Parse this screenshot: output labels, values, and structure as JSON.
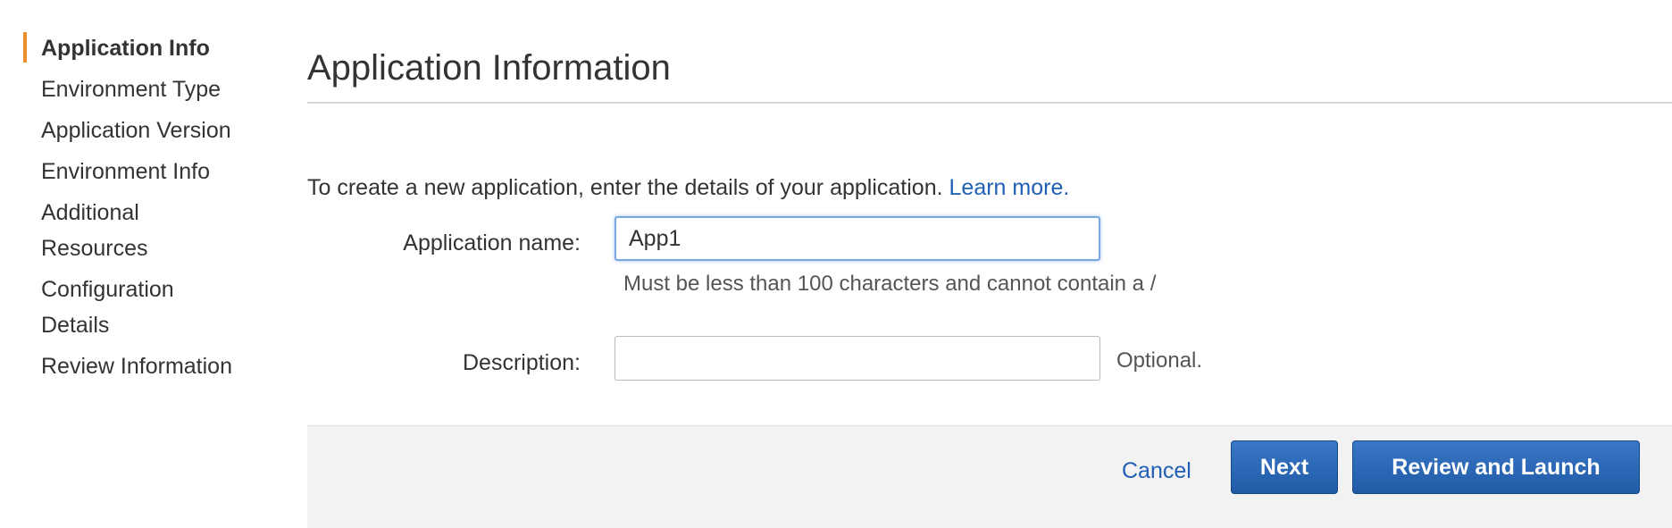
{
  "sidebar": {
    "items": [
      {
        "label": "Application Info",
        "active": true
      },
      {
        "label": "Environment Type"
      },
      {
        "label": "Application Version"
      },
      {
        "label": "Environment Info"
      },
      {
        "label": "Additional Resources"
      },
      {
        "label": "Configuration Details"
      },
      {
        "label": "Review Information"
      }
    ]
  },
  "main": {
    "title": "Application Information",
    "intro_text": "To create a new application, enter the details of your application.",
    "learn_more": "Learn more.",
    "form": {
      "app_name_label": "Application name:",
      "app_name_value": "App1",
      "app_name_hint": "Must be less than 100 characters and cannot contain a /",
      "description_label": "Description:",
      "description_value": "",
      "description_optional": "Optional."
    }
  },
  "footer": {
    "cancel_label": "Cancel",
    "next_label": "Next",
    "review_label": "Review and Launch"
  },
  "colors": {
    "accent": "#e7902c",
    "link": "#1f5fb4",
    "button": "#2a67b5",
    "footer_bg": "#f2f2f2"
  }
}
